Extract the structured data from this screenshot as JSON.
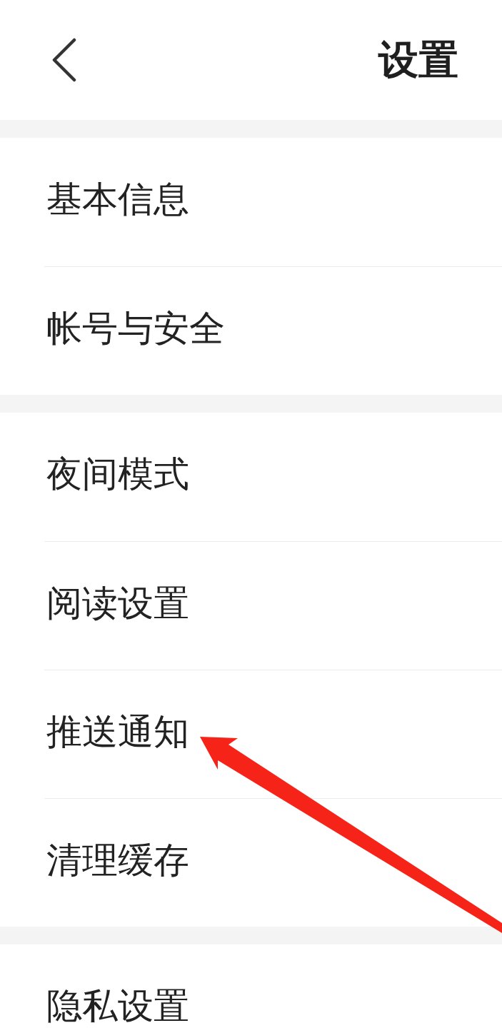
{
  "header": {
    "title": "设置"
  },
  "sections": [
    {
      "items": [
        {
          "label": "基本信息",
          "pointed_at": false
        },
        {
          "label": "帐号与安全",
          "pointed_at": false
        }
      ]
    },
    {
      "items": [
        {
          "label": "夜间模式",
          "pointed_at": false
        },
        {
          "label": "阅读设置",
          "pointed_at": false
        },
        {
          "label": "推送通知",
          "pointed_at": true
        },
        {
          "label": "清理缓存",
          "pointed_at": false
        }
      ]
    },
    {
      "items": [
        {
          "label": "隐私设置",
          "pointed_at": false
        }
      ]
    }
  ]
}
